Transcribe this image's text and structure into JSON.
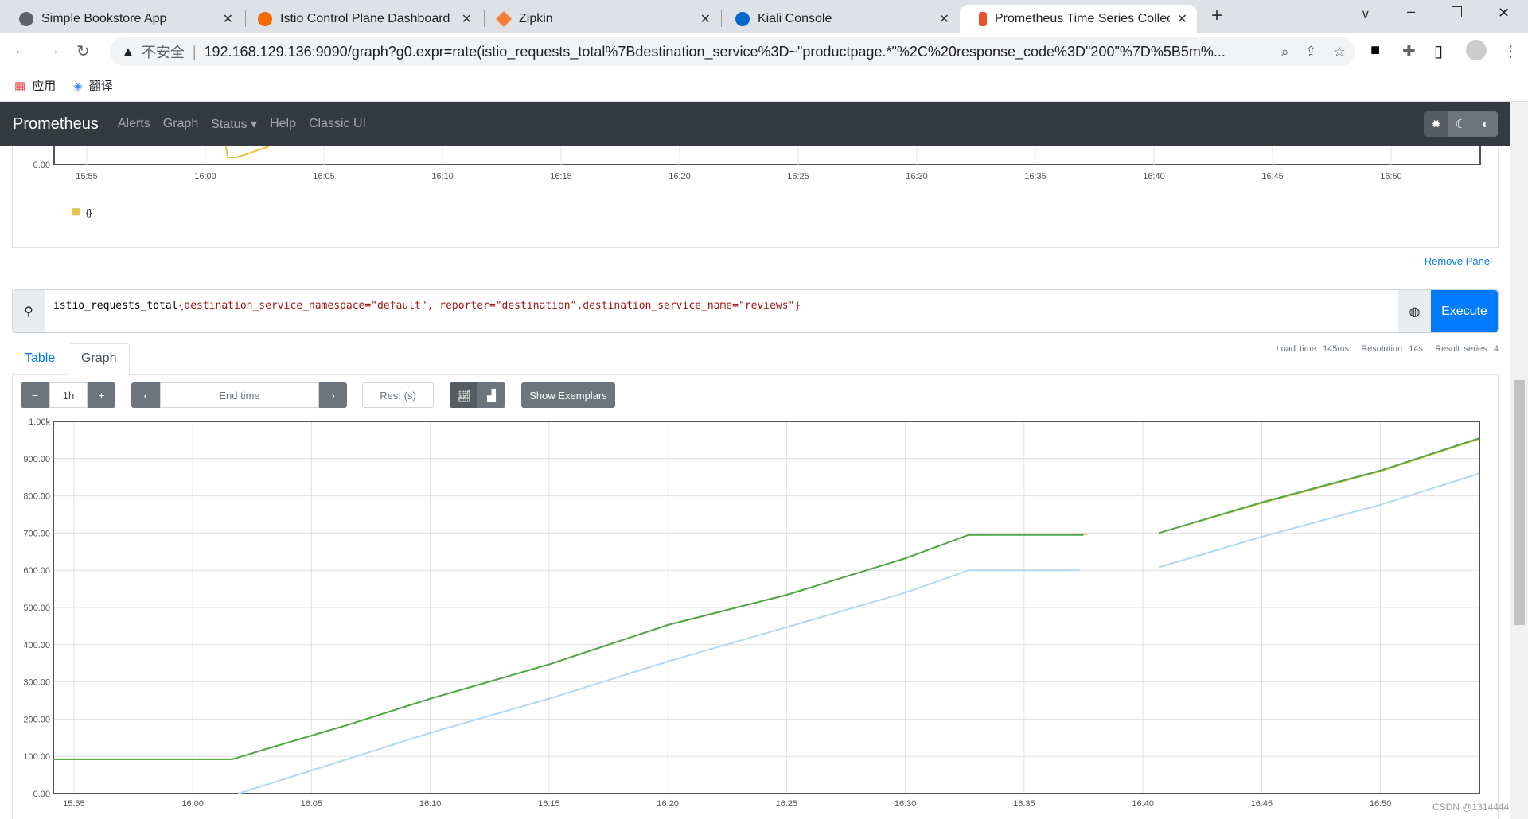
{
  "browser": {
    "tabs": [
      {
        "title": "Simple Bookstore App",
        "icon": "globe-icon",
        "color": "#5f6368"
      },
      {
        "title": "Istio Control Plane Dashboard",
        "icon": "grafana-icon",
        "color": "#f46800"
      },
      {
        "title": "Zipkin",
        "icon": "zipkin-icon",
        "color": "#f57c3a"
      },
      {
        "title": "Kiali Console",
        "icon": "kiali-icon",
        "color": "#0066cc"
      },
      {
        "title": "Prometheus Time Series Collec",
        "icon": "prometheus-icon",
        "color": "#e6522c"
      }
    ],
    "security": "不安全",
    "url": "192.168.129.136:9090/graph?g0.expr=rate(istio_requests_total%7Bdestination_service%3D~\"productpage.*\"%2C%20response_code%3D\"200\"%7D%5B5m%...",
    "bookmarks": [
      "应用",
      "翻译"
    ]
  },
  "nav": {
    "brand": "Prometheus",
    "links": [
      "Alerts",
      "Graph",
      "Status",
      "Help",
      "Classic UI"
    ]
  },
  "top_panel": {
    "y_tick": "0.00",
    "x_ticks": [
      "15:55",
      "16:00",
      "16:05",
      "16:10",
      "16:15",
      "16:20",
      "16:25",
      "16:30",
      "16:35",
      "16:40",
      "16:45",
      "16:50"
    ],
    "legend": "{}",
    "legend_color": "#edc240",
    "remove_label": "Remove Panel"
  },
  "query": {
    "metric": "istio_requests_total",
    "labels": "{destination_service_namespace=\"default\", reporter=\"destination\",destination_service_name=\"reviews\"}",
    "execute": "Execute"
  },
  "panel_tabs": [
    "Table",
    "Graph"
  ],
  "stats": {
    "load": "Load time: 145ms",
    "resolution": "Resolution: 14s",
    "series": "Result series: 4"
  },
  "controls": {
    "range": "1h",
    "end_time_placeholder": "End time",
    "res_placeholder": "Res. (s)",
    "exemplars": "Show Exemplars"
  },
  "watermark": "CSDN @1314444",
  "chart_data": {
    "type": "line",
    "xlim": [
      "15:54:08",
      "16:54:10"
    ],
    "ylim": [
      0,
      1000
    ],
    "grid": true,
    "y_ticks": [
      "0.00",
      "100.00",
      "200.00",
      "300.00",
      "400.00",
      "500.00",
      "600.00",
      "700.00",
      "800.00",
      "900.00",
      "1.00k"
    ],
    "x_ticks": [
      "15:55",
      "16:00",
      "16:05",
      "16:10",
      "16:15",
      "16:20",
      "16:25",
      "16:30",
      "16:35",
      "16:40",
      "16:45",
      "16:50"
    ],
    "series": [
      {
        "color": "#edc240",
        "points": [
          [
            "15:54:08",
            92
          ],
          [
            "16:01:40",
            92
          ],
          [
            "16:03:00",
            118
          ],
          [
            "16:06:30",
            184
          ],
          [
            "16:10:00",
            255
          ],
          [
            "16:15:00",
            347
          ],
          [
            "16:20:00",
            453
          ],
          [
            "16:25:00",
            534
          ],
          [
            "16:30:00",
            632
          ],
          [
            "16:32:40",
            695
          ],
          [
            "16:37:40",
            697
          ],
          null,
          [
            "16:40:40",
            700
          ],
          [
            "16:45:05",
            782
          ],
          [
            "16:50:00",
            866
          ],
          [
            "16:54:10",
            953
          ]
        ]
      },
      {
        "color": "#4da74d",
        "points": [
          [
            "15:54:08",
            92
          ],
          [
            "16:01:40",
            92
          ],
          [
            "16:03:00",
            118
          ],
          [
            "16:06:30",
            184
          ],
          [
            "16:10:00",
            255
          ],
          [
            "16:15:00",
            347
          ],
          [
            "16:20:00",
            453
          ],
          [
            "16:25:00",
            534
          ],
          [
            "16:30:00",
            632
          ],
          [
            "16:32:40",
            695
          ],
          [
            "16:37:30",
            695
          ],
          null,
          [
            "16:40:40",
            700
          ],
          [
            "16:45:05",
            784
          ],
          [
            "16:50:00",
            868
          ],
          [
            "16:54:10",
            955
          ]
        ]
      },
      {
        "color": "#afd8f8",
        "points": [
          [
            "16:01:55",
            0
          ],
          [
            "16:05:00",
            62
          ],
          [
            "16:10:00",
            163
          ],
          [
            "16:15:00",
            255
          ],
          [
            "16:20:00",
            355
          ],
          [
            "16:25:00",
            447
          ],
          [
            "16:30:00",
            540
          ],
          [
            "16:32:40",
            600
          ],
          [
            "16:37:20",
            600
          ],
          null,
          [
            "16:40:40",
            608
          ],
          [
            "16:45:00",
            690
          ],
          [
            "16:50:00",
            776
          ],
          [
            "16:54:10",
            860
          ]
        ]
      }
    ]
  }
}
